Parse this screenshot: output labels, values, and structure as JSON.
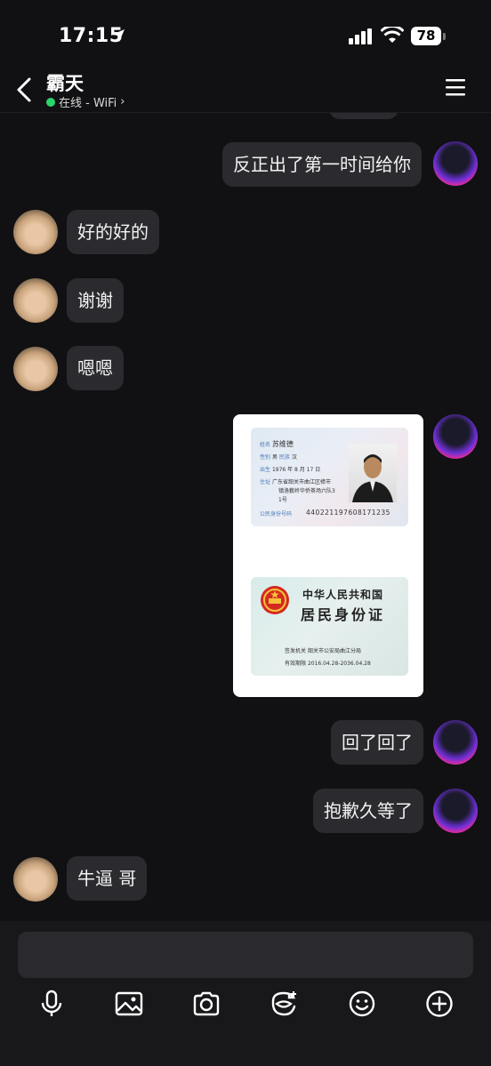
{
  "status_bar": {
    "time": "17:15",
    "battery": "78"
  },
  "header": {
    "contact_name": "霸天",
    "presence": "在线 - WiFi",
    "presence_chevron": "›"
  },
  "messages": [
    {
      "side": "right",
      "text": "反正出了第一时间给你"
    },
    {
      "side": "left",
      "text": "好的好的"
    },
    {
      "side": "left",
      "text": "谢谢"
    },
    {
      "side": "left",
      "text": "嗯嗯"
    },
    {
      "side": "right",
      "type": "image"
    },
    {
      "side": "right",
      "text": "回了回了"
    },
    {
      "side": "right",
      "text": "抱歉久等了"
    },
    {
      "side": "left",
      "text": "牛逼 哥"
    }
  ],
  "id_card": {
    "front": {
      "name_label": "姓名",
      "name": "苏维德",
      "sex_label": "性别",
      "sex": "男",
      "ethnicity_label": "民族",
      "ethnicity": "汉",
      "birth_label": "出生",
      "birth": "1976  年  8  月 17 日",
      "address_label": "住址",
      "address_1": "广东省韶关市曲江区樟市",
      "address_2": "镇洛薮岭华侨茶场六队3",
      "address_3": "1号",
      "id_label": "公民身份号码",
      "id_number": "440221197608171235"
    },
    "back": {
      "country": "中华人民共和国",
      "title": "居民身份证",
      "authority_label": "签发机关",
      "authority": "韶关市公安局曲江分局",
      "validity_label": "有效期限",
      "validity": "2016.04.28-2036.04.28"
    }
  },
  "toolbar": [
    "microphone-icon",
    "image-icon",
    "camera-icon",
    "sticker-icon",
    "emoji-icon",
    "plus-icon"
  ],
  "colors": {
    "background": "#111113",
    "bubble": "#2b2b2f",
    "online": "#2bd36b"
  }
}
